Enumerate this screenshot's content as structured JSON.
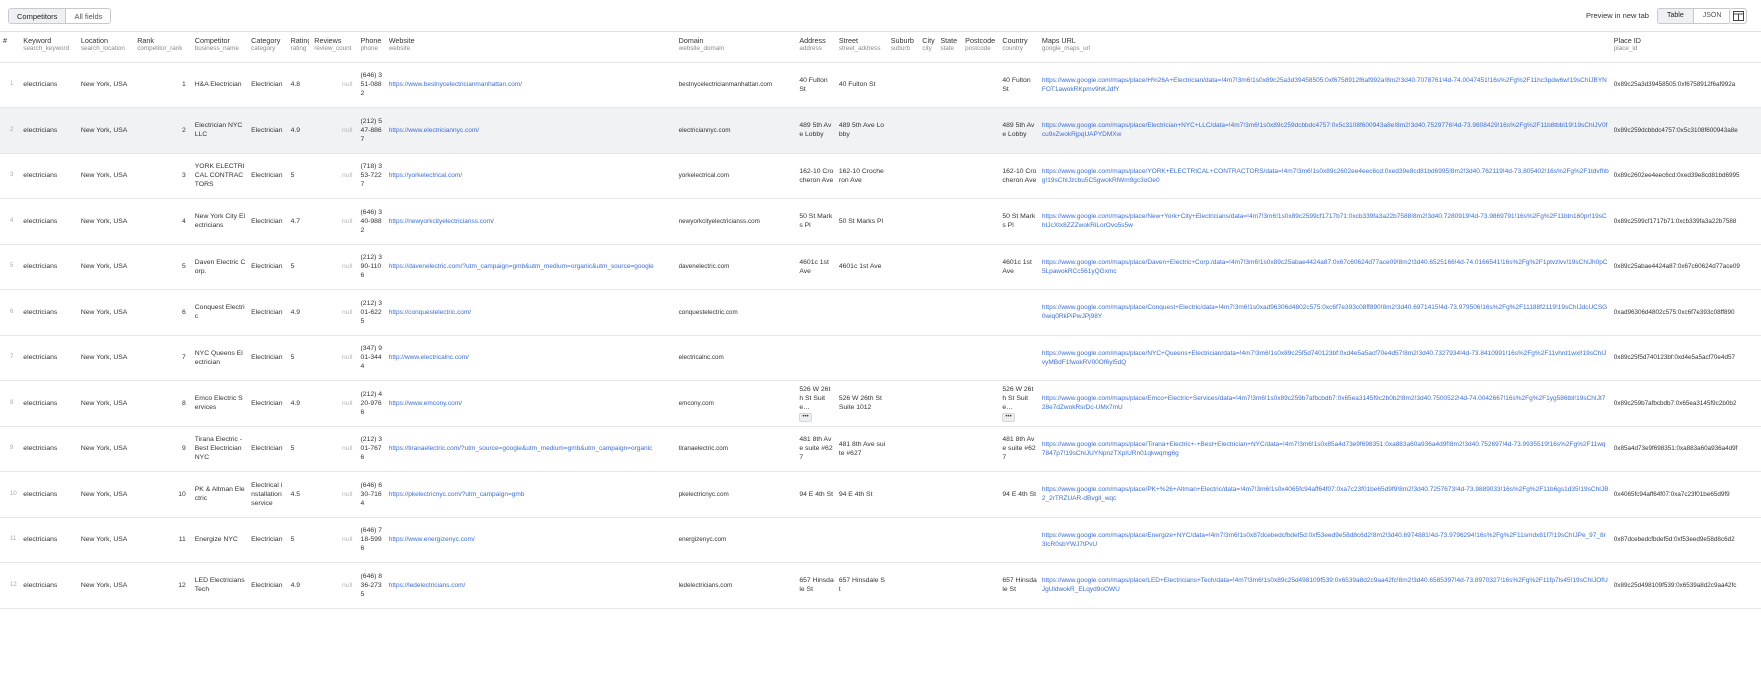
{
  "toolbar": {
    "tabs": [
      "Competitors",
      "All fields"
    ],
    "preview_label": "Preview in new tab",
    "view_tabs": [
      "Table",
      "JSON"
    ],
    "layout_icon": "columns-icon"
  },
  "columns": [
    {
      "label": "#",
      "field": ""
    },
    {
      "label": "Keyword",
      "field": "search_keyword"
    },
    {
      "label": "Location",
      "field": "search_location"
    },
    {
      "label": "Rank",
      "field": "competitor_rank"
    },
    {
      "label": "Competitor",
      "field": "business_name"
    },
    {
      "label": "Category",
      "field": "category"
    },
    {
      "label": "Rating",
      "field": "rating"
    },
    {
      "label": "Reviews",
      "field": "review_count"
    },
    {
      "label": "Phone",
      "field": "phone"
    },
    {
      "label": "Website",
      "field": "website"
    },
    {
      "label": "Domain",
      "field": "website_domain"
    },
    {
      "label": "Address",
      "field": "address"
    },
    {
      "label": "Street",
      "field": "street_address"
    },
    {
      "label": "Suburb",
      "field": "suburb"
    },
    {
      "label": "City",
      "field": "city"
    },
    {
      "label": "State",
      "field": "state"
    },
    {
      "label": "Postcode",
      "field": "postcode"
    },
    {
      "label": "Country",
      "field": "country"
    },
    {
      "label": "Maps URL",
      "field": "google_maps_url"
    },
    {
      "label": "Place ID",
      "field": "place_id"
    }
  ],
  "rows": [
    {
      "idx": "1",
      "keyword": "electricians",
      "location": "New York, USA",
      "rank": "1",
      "name": "H&A Electrician",
      "category": "Electrician",
      "rating": "4.8",
      "reviews": "null",
      "phone": "(646) 351-0882",
      "website": "https://www.bestnycelectricianmanhattan.com/",
      "domain": "bestnycelectricianmanhattan.com",
      "address": "40 Fulton St",
      "street": "40 Fulton St",
      "country": "40 Fulton St",
      "maps": "https://www.google.com/maps/place/H%26A+Electrician/data=!4m7!3m6!1s0x89c25a3d39458505:0xf6758912f6af992a!8m2!3d40.7078761!4d-74.0047451!16s%2Fg%2F11hc3pdw6w!19sChIJBYNFOT1awokRKpmv9hKJdfY",
      "place_id": "0x89c25a3d39458505:0xf6758912f6af992a"
    },
    {
      "idx": "2",
      "keyword": "electricians",
      "location": "New York, USA",
      "rank": "2",
      "name": "Electrician NYC LLC",
      "category": "Electrician",
      "rating": "4.9",
      "reviews": "null",
      "phone": "(212) 547-8867",
      "website": "https://www.electriciannyc.com/",
      "domain": "electriciannyc.com",
      "address": "489 5th Ave Lobby",
      "street": "489 5th Ave Lobby",
      "country": "489 5th Ave Lobby",
      "maps": "https://www.google.com/maps/place/Electrician+NYC+LLC/data=!4m7!3m6!1s0x89c259dcbbdc4757:0x5c3108f600943a8e!8m2!3d40.7529776!4d-73.9808429!16s%2Fg%2F11b8tbbl19!19sChIJV0fcu9xZwokRjpqUAPYDMXw",
      "place_id": "0x89c259dcbbdc4757:0x5c3108f600943a8e"
    },
    {
      "idx": "3",
      "keyword": "electricians",
      "location": "New York, USA",
      "rank": "3",
      "name": "YORK ELECTRICAL CONTRACTORS",
      "category": "Electrician",
      "rating": "5",
      "reviews": "null",
      "phone": "(718) 353-7227",
      "website": "https://yorkelectrical.com/",
      "domain": "yorkelectrical.com",
      "address": "162-10 Crocheron Ave",
      "street": "162-10 Crocheron Ave",
      "country": "162-10 Crocheron Ave",
      "maps": "https://www.google.com/maps/place/YORK+ELECTRICAL+CONTRACTORS/data=!4m7!3m6!1s0x89c2602ee4eec6cd:0xed39e8cd81bd6995!8m2!3d40.762119!4d-73.805402!16s%2Fg%2F1tdvfhbg!19sChIJzcbu5C5gwokRlWm9gc3oOe0",
      "place_id": "0x89c2602ee4eec6cd:0xed39e8cd81bd6995"
    },
    {
      "idx": "4",
      "keyword": "electricians",
      "location": "New York, USA",
      "rank": "4",
      "name": "New York City Electricians",
      "category": "Electrician",
      "rating": "4.7",
      "reviews": "null",
      "phone": "(646) 340-9882",
      "website": "https://newyorkcityelectricianss.com/",
      "domain": "newyorkcityelectricianss.com",
      "address": "50 St Marks Pl",
      "street": "50 St Marks Pl",
      "country": "50 St Marks Pl",
      "maps": "https://www.google.com/maps/place/New+York+City+Electricians/data=!4m7!3m6!1s0x89c2599cf1717b71:0xcb339fa3a22b7588!8m2!3d40.7280919!4d-73.9869791!16s%2Fg%2F11btn160pr!19sChIJcXtx8ZZZwokRiLorOvo5s5w",
      "place_id": "0x89c2599cf1717b71:0xcb339fa3a22b7588"
    },
    {
      "idx": "5",
      "keyword": "electricians",
      "location": "New York, USA",
      "rank": "5",
      "name": "Daven Electric Corp.",
      "category": "Electrician",
      "rating": "5",
      "reviews": "null",
      "phone": "(212) 390-1106",
      "website": "https://davenelectric.com/?utm_campaign=gmb&utm_medium=organic&utm_source=google",
      "domain": "davenelectric.com",
      "address": "4601c 1st Ave",
      "street": "4601c 1st Ave",
      "country": "4601c 1st Ave",
      "maps": "https://www.google.com/maps/place/Daven+Electric+Corp./data=!4m7!3m6!1s0x89c25abae4424a87:0x67c60624d77ace09!8m2!3d40.6525166!4d-74.0166541!16s%2Fg%2F1ptvzlvv!19sChIJh0pC5LpawokRCc561yQGxmc",
      "place_id": "0x89c25abae4424a87:0x67c60624d77ace09"
    },
    {
      "idx": "6",
      "keyword": "electricians",
      "location": "New York, USA",
      "rank": "6",
      "name": "Conquest Electric",
      "category": "Electrician",
      "rating": "4.9",
      "reviews": "null",
      "phone": "(212) 301-6225",
      "website": "https://conquestelectric.com/",
      "domain": "conquestelectric.com",
      "address": "",
      "street": "",
      "country": "",
      "maps": "https://www.google.com/maps/place/Conquest+Electric/data=!4m7!3m6!1s0xad96306d4802c575:0xc6f7e393c08ff890!8m2!3d40.6971415!4d-73.979506!16s%2Fg%2F11188f2119!19sChIJdcUCSG0wiq0RkPiPwJPj98Y",
      "place_id": "0xad96306d4802c575:0xc6f7e393c08ff890"
    },
    {
      "idx": "7",
      "keyword": "electricians",
      "location": "New York, USA",
      "rank": "7",
      "name": "NYC Queens Electrician",
      "category": "Electrician",
      "rating": "5",
      "reviews": "null",
      "phone": "(347) 901-3444",
      "website": "http://www.electricalnc.com/",
      "domain": "electricalnc.com",
      "address": "",
      "street": "",
      "country": "",
      "maps": "https://www.google.com/maps/place/NYC+Queens+Electrician/data=!4m7!3m6!1s0x89c25f5d740123bf:0xd4e5a5acf70e4d57!8m2!3d40.7327934!4d-73.8410991!16s%2Fg%2F11vhrd1wxl!19sChIJvyMBdF1fwokRV00Of6yl5dQ",
      "place_id": "0x89c25f5d740123bf:0xd4e5a5acf70e4d57"
    },
    {
      "idx": "8",
      "keyword": "electricians",
      "location": "New York, USA",
      "rank": "8",
      "name": "Emco Electric Services",
      "category": "Electrician",
      "rating": "4.9",
      "reviews": "null",
      "phone": "(212) 420-9766",
      "website": "https://www.emcony.com/",
      "domain": "emcony.com",
      "address": "526 W 26th St Suite…",
      "street": "526 W 26th St Suite 1012",
      "country": "526 W 26th St Suite…",
      "maps": "https://www.google.com/maps/place/Emco+Electric+Services/data=!4m7!3m6!1s0x89c259b7afbcbdb7:0x65ea3145f9c2b0b2!8m2!3d40.7500522!4d-74.0042667!16s%2Fg%2F1yg586tbl!19sChIJt728e7dZwokRsrDc-UMx7mU",
      "place_id": "0x89c259b7afbcbdb7:0x65ea3145f9c2b0b2"
    },
    {
      "idx": "9",
      "keyword": "electricians",
      "location": "New York, USA",
      "rank": "9",
      "name": "Tirana Electric - Best Electrician NYC",
      "category": "Electrician",
      "rating": "5",
      "reviews": "null",
      "phone": "(212) 301-7676",
      "website": "https://tiranaelectric.com/?utm_source=google&utm_medium=gmb&utm_campaign=organic",
      "domain": "tiranaelectric.com",
      "address": "481 8th Ave suite #627",
      "street": "481 8th Ave suite #627",
      "country": "481 8th Ave suite #627",
      "maps": "https://www.google.com/maps/place/Tirana+Electric+-+Best+Electrician+NYC/data=!4m7!3m6!1s0x85a4d73e9f698351:0xa883a60a936a4d9f!8m2!3d40.752697!4d-73.9935519!16s%2Fg%2F11wq7847p7!19sChIJUYNpnzTXpIURn01qkwqmg6g",
      "place_id": "0x85a4d73e9f698351:0xa883a60a936a4d9f"
    },
    {
      "idx": "10",
      "keyword": "electricians",
      "location": "New York, USA",
      "rank": "10",
      "name": "PK & Altman Electric",
      "category": "Electrical installation service",
      "rating": "4.5",
      "reviews": "null",
      "phone": "(646) 630-7164",
      "website": "https://pkelectricnyc.com/?utm_campaign=gmb",
      "domain": "pkelectricnyc.com",
      "address": "94 E 4th St",
      "street": "94 E 4th St",
      "country": "94 E 4th St",
      "maps": "https://www.google.com/maps/place/PK+%26+Altman+Electric/data=!4m7!3m6!1s0x4065fc94aff64f07:0xa7c23f01be65d9f9!8m2!3d40.7257673!4d-73.9889033!16s%2Fg%2F11b6gs1d35!19sChIJB2_2rTRZUAR-dBvgll_wqc",
      "place_id": "0x4065fc94aff64f07:0xa7c23f01be65d9f9"
    },
    {
      "idx": "11",
      "keyword": "electricians",
      "location": "New York, USA",
      "rank": "11",
      "name": "Energize NYC",
      "category": "Electrician",
      "rating": "5",
      "reviews": "null",
      "phone": "(646) 718-5996",
      "website": "https://www.energizenyc.com/",
      "domain": "energizenyc.com",
      "address": "",
      "street": "",
      "country": "",
      "maps": "https://www.google.com/maps/place/Energize+NYC/data=!4m7!3m6!1s0x87dcebedcfbdef5d:0xf53eed9e58d8c6d2!8m2!3d40.6974881!4d-73.9796294!16s%2Fg%2F11smdx81f7!19sChIJPe_97_8r3IcR0sbYWJ7tPvU",
      "place_id": "0x87dcebedcfbdef5d:0xf53eed9e58d8c6d2"
    },
    {
      "idx": "12",
      "keyword": "electricians",
      "location": "New York, USA",
      "rank": "12",
      "name": "LED Electricians Tech",
      "category": "Electrician",
      "rating": "4.9",
      "reviews": "null",
      "phone": "(646) 836-2735",
      "website": "https://ledelectricians.com/",
      "domain": "ledelectricians.com",
      "address": "657 Hinsdale St",
      "street": "657 Hinsdale St",
      "country": "657 Hinsdale St",
      "maps": "https://www.google.com/maps/place/LED+Electricians+Tech/data=!4m7!3m6!1s0x89c25d498109f539:0x6539a8d2c9aa42fc!8m2!3d40.6585397!4d-73.8970327!16s%2Fg%2F11fp7ls45!19sChIJOfUJgUldwokR_ELqyd9oOWU",
      "place_id": "0x89c25d498109f539:0x6539a8d2c9aa42fc"
    }
  ],
  "selected_row_index": 1,
  "colors": {
    "link": "#3b6fd8",
    "null": "#b5b5b5",
    "selected_row": "#f1f2f4",
    "border": "#e3e3e3"
  }
}
